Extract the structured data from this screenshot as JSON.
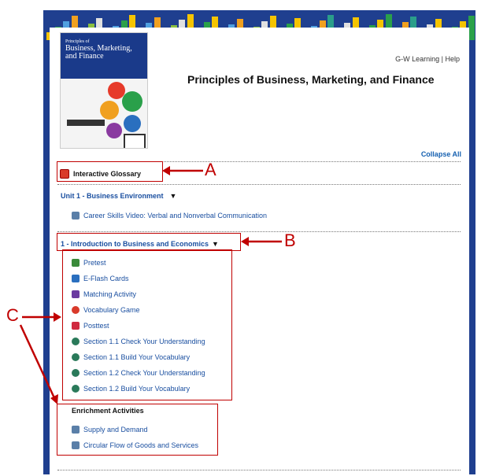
{
  "header": {
    "book_title_line1": "Principles of",
    "book_title_line2": "Business, Marketing,",
    "book_title_line3": "and Finance",
    "gw_link": "G-W Learning",
    "separator": "|",
    "help_link": "Help",
    "page_title": "Principles of Business, Marketing, and Finance"
  },
  "collapse_all": "Collapse All",
  "glossary": {
    "label": "Interactive Glossary"
  },
  "unit": {
    "label": "Unit 1 - Business Environment",
    "arrow": "▼"
  },
  "unit_items": [
    {
      "label": "Career Skills Video: Verbal and Nonverbal Communication",
      "icon": "video-icon"
    }
  ],
  "chapter": {
    "label": "1 - Introduction to Business and Economics",
    "arrow": "▼"
  },
  "chapter_items": [
    {
      "label": "Pretest",
      "icon": "document-icon",
      "color": "#3a8a3a"
    },
    {
      "label": "E-Flash Cards",
      "icon": "flashcard-icon",
      "color": "#2a6fbf"
    },
    {
      "label": "Matching Activity",
      "icon": "matching-icon",
      "color": "#6a3aa0"
    },
    {
      "label": "Vocabulary Game",
      "icon": "game-icon",
      "color": "#d93a2a"
    },
    {
      "label": "Posttest",
      "icon": "posttest-icon",
      "color": "#d02a40"
    },
    {
      "label": "Section 1.1 Check Your Understanding",
      "icon": "globe-icon",
      "color": "#2a7a5a"
    },
    {
      "label": "Section 1.1 Build Your Vocabulary",
      "icon": "globe-icon",
      "color": "#2a7a5a"
    },
    {
      "label": "Section 1.2 Check Your Understanding",
      "icon": "globe-icon",
      "color": "#2a7a5a"
    },
    {
      "label": "Section 1.2 Build Your Vocabulary",
      "icon": "globe-icon",
      "color": "#2a7a5a"
    }
  ],
  "enrichment": {
    "heading": "Enrichment Activities",
    "items": [
      {
        "label": "Supply and Demand",
        "icon": "video-icon"
      },
      {
        "label": "Circular Flow of Goods and Services",
        "icon": "video-icon"
      }
    ]
  },
  "annotations": {
    "a": "A",
    "b": "B",
    "c": "C",
    "color": "#c00000"
  }
}
